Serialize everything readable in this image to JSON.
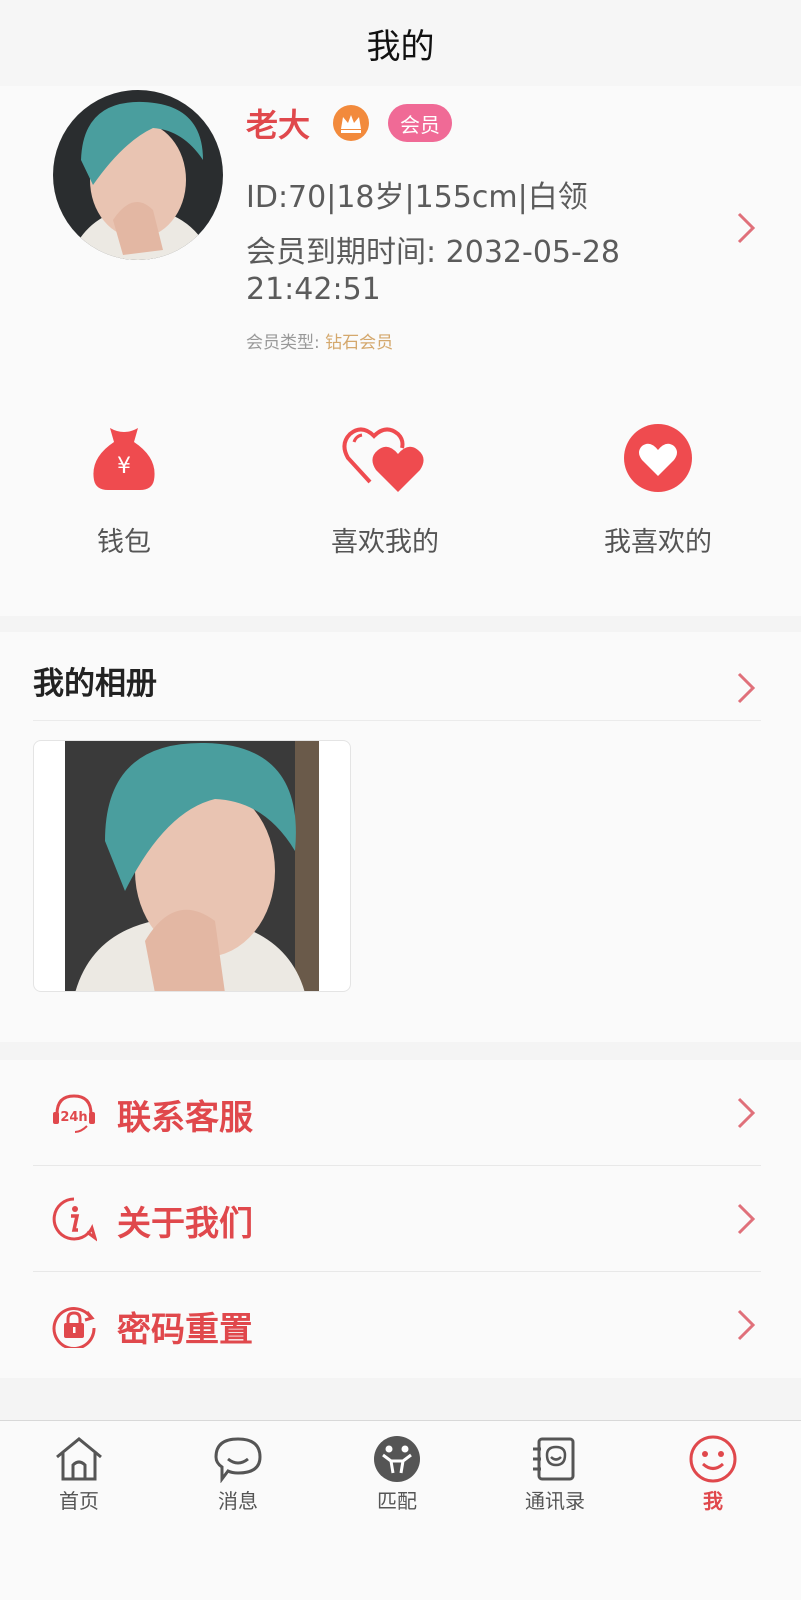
{
  "header": {
    "title": "我的"
  },
  "profile": {
    "name": "老大",
    "badge": "会员",
    "info": "ID:70|18岁|155cm|白领",
    "expiry_line1": "会员到期时间: 2032-05-28",
    "expiry_line2": "21:42:51",
    "vip_type_label": "会员类型:",
    "vip_type_value": "钻石会员"
  },
  "quick_actions": [
    {
      "label": "钱包",
      "icon": "wallet-icon"
    },
    {
      "label": "喜欢我的",
      "icon": "hearts-icon"
    },
    {
      "label": "我喜欢的",
      "icon": "heart-circle-icon"
    }
  ],
  "album": {
    "title": "我的相册"
  },
  "menu": [
    {
      "label": "联系客服",
      "icon": "headset-24h-icon"
    },
    {
      "label": "关于我们",
      "icon": "info-icon"
    },
    {
      "label": "密码重置",
      "icon": "lock-reset-icon"
    }
  ],
  "tabbar": [
    {
      "label": "首页",
      "icon": "home-icon"
    },
    {
      "label": "消息",
      "icon": "message-icon"
    },
    {
      "label": "匹配",
      "icon": "match-icon"
    },
    {
      "label": "通讯录",
      "icon": "contacts-icon"
    },
    {
      "label": "我",
      "icon": "smiley-icon",
      "active": true
    }
  ],
  "colors": {
    "accent": "#e0484c",
    "badge": "#f06a96",
    "crown": "#f28a3c",
    "vip_value": "#d4a86d"
  }
}
